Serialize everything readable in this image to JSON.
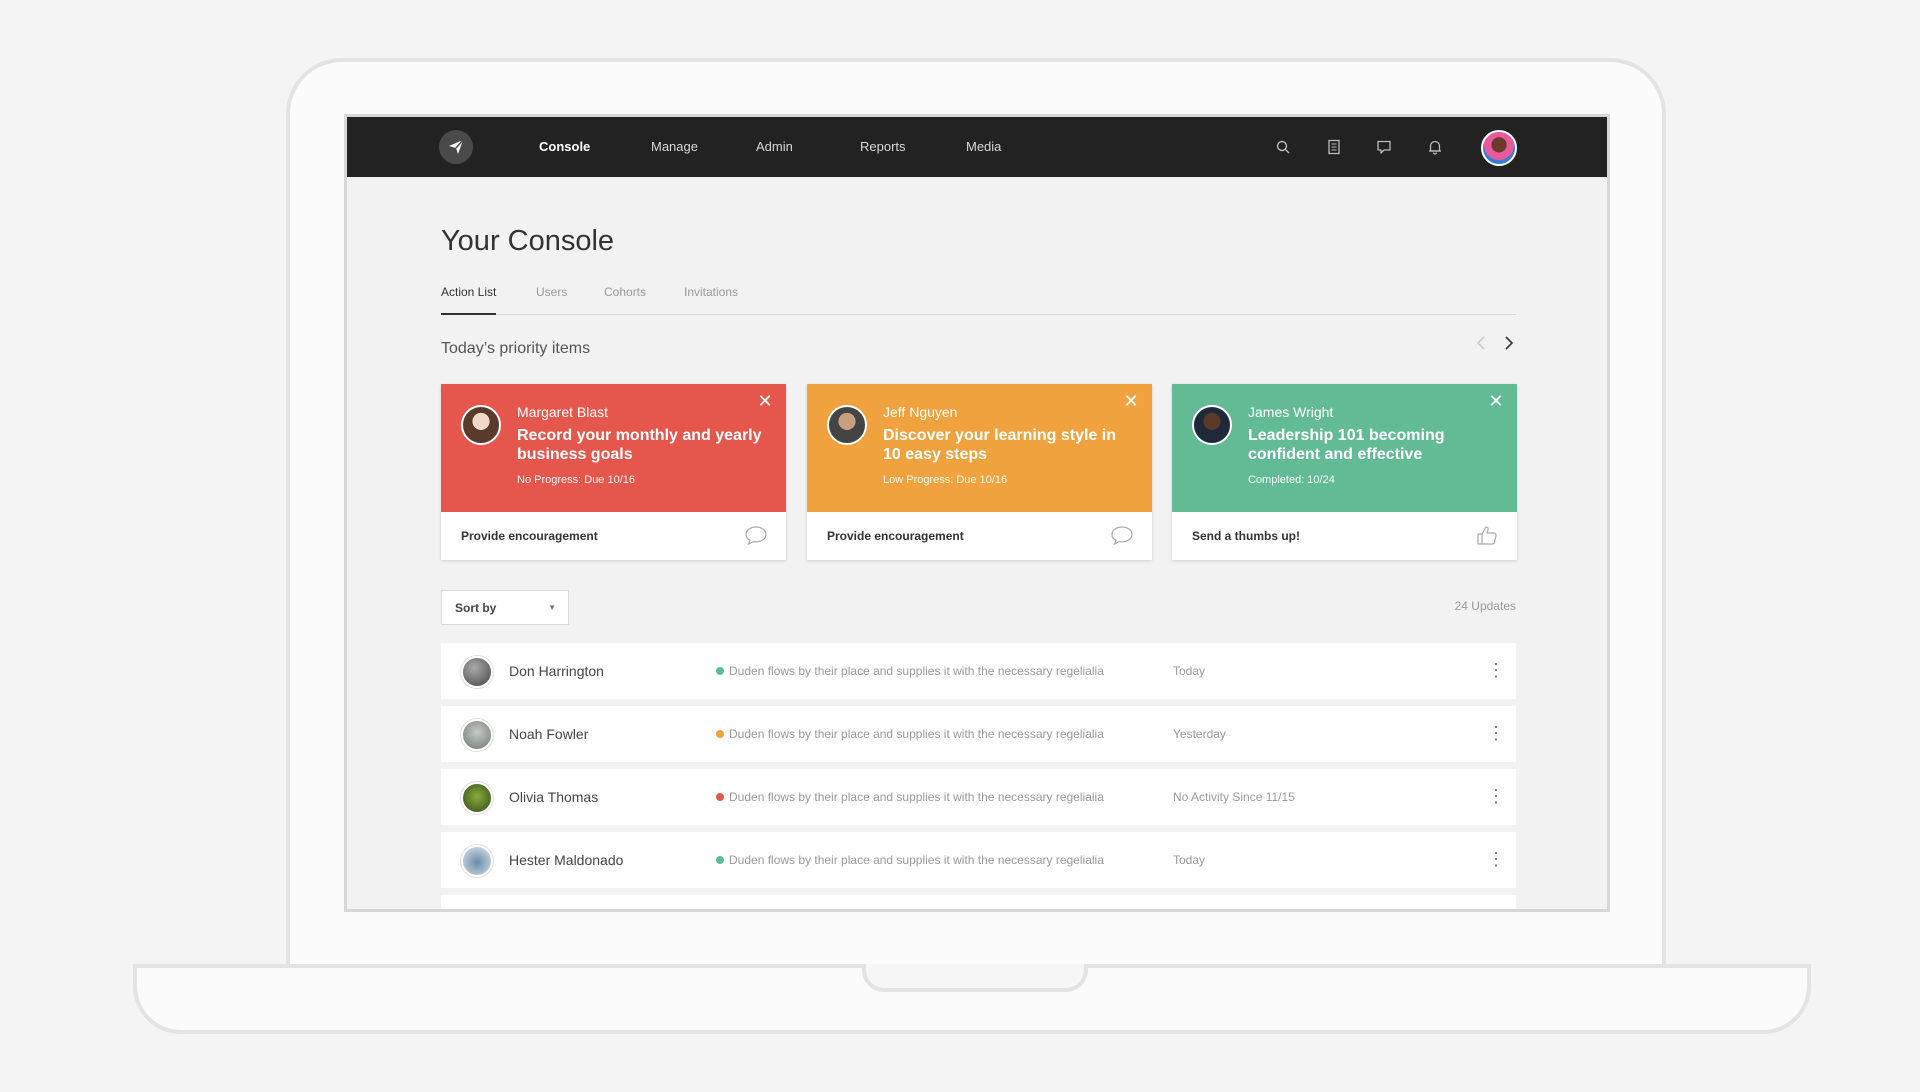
{
  "nav": {
    "items": [
      {
        "label": "Console",
        "active": true
      },
      {
        "label": "Manage",
        "active": false
      },
      {
        "label": "Admin",
        "active": false
      },
      {
        "label": "Reports",
        "active": false
      },
      {
        "label": "Media",
        "active": false
      }
    ],
    "icons": [
      "search-icon",
      "document-icon",
      "chat-icon",
      "bell-icon"
    ]
  },
  "page": {
    "title": "Your Console",
    "tabs": [
      {
        "label": "Action List",
        "active": true
      },
      {
        "label": "Users",
        "active": false
      },
      {
        "label": "Cohorts",
        "active": false
      },
      {
        "label": "Invitations",
        "active": false
      }
    ]
  },
  "priority": {
    "title": "Today’s priority items",
    "cards": [
      {
        "name": "Margaret Blast",
        "title": "Record your monthly and yearly business goals",
        "status": "No Progress: Due 10/16",
        "action": "Provide encouragement",
        "action_icon": "comment-icon",
        "color": "#e5574d"
      },
      {
        "name": "Jeff Nguyen",
        "title": "Discover your learning style in 10 easy steps",
        "status": "Low Progress: Due 10/16",
        "action": "Provide encouragement",
        "action_icon": "comment-icon",
        "color": "#efa23e"
      },
      {
        "name": "James Wright",
        "title": "Leadership 101 becoming confident and effective",
        "status": "Completed: 10/24",
        "action": "Send a thumbs up!",
        "action_icon": "thumbs-up-icon",
        "color": "#63bb95"
      }
    ]
  },
  "list": {
    "sort_label": "Sort by",
    "updates_count": "24 Updates",
    "rows": [
      {
        "name": "Don Harrington",
        "message": "Duden flows by their place and supplies it with the necessary regelialia",
        "time": "Today",
        "status_color": "#5bbd94"
      },
      {
        "name": "Noah Fowler",
        "message": "Duden flows by their place and supplies it with the necessary regelialia",
        "time": "Yesterday",
        "status_color": "#efa23e"
      },
      {
        "name": "Olivia Thomas",
        "message": "Duden flows by their place and supplies it with the necessary regelialia",
        "time": "No Activity Since 11/15",
        "status_color": "#e5574d"
      },
      {
        "name": "Hester Maldonado",
        "message": "Duden flows by their place and supplies it with the necessary regelialia",
        "time": "Today",
        "status_color": "#5bbd94"
      }
    ]
  }
}
